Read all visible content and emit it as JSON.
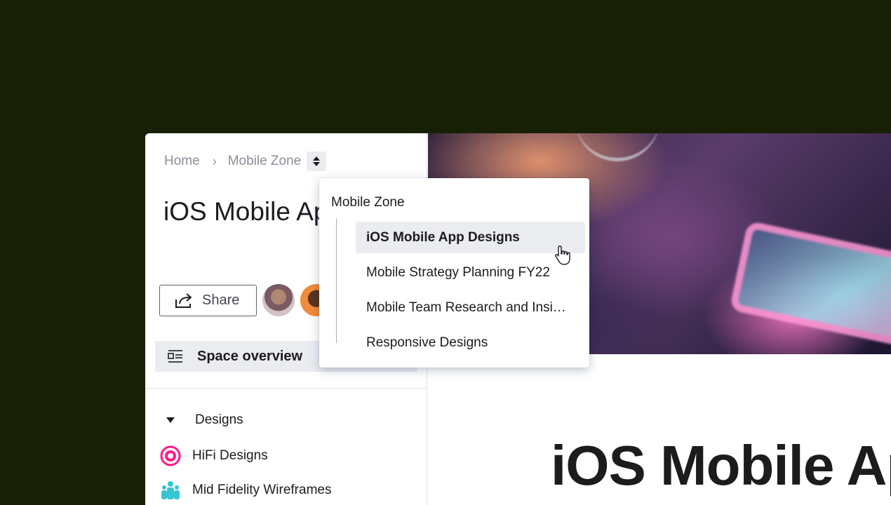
{
  "breadcrumb": {
    "home": "Home",
    "separator": "›",
    "current": "Mobile Zone"
  },
  "sidebar": {
    "page_title": "iOS Mobile App Designs",
    "share_label": "Share",
    "overview_label": "Space overview",
    "section_label": "Designs",
    "items": [
      {
        "label": "HiFi Designs",
        "icon": "target-icon",
        "color": "#ff1a8c"
      },
      {
        "label": "Mid Fidelity Wireframes",
        "icon": "people-icon",
        "color": "#36c5d3"
      }
    ]
  },
  "main": {
    "title": "iOS Mobile App Designs"
  },
  "dropdown": {
    "heading": "Mobile Zone",
    "items": [
      {
        "label": "iOS Mobile App Designs",
        "selected": true
      },
      {
        "label": "Mobile Strategy Planning FY22",
        "selected": false
      },
      {
        "label": "Mobile Team Research and Insights",
        "selected": false
      },
      {
        "label": "Responsive Designs",
        "selected": false
      }
    ]
  },
  "colors": {
    "background": "#172005",
    "selected_bg": "#ebecf0",
    "accent_pink": "#ff1a8c",
    "accent_teal": "#36c5d3"
  }
}
